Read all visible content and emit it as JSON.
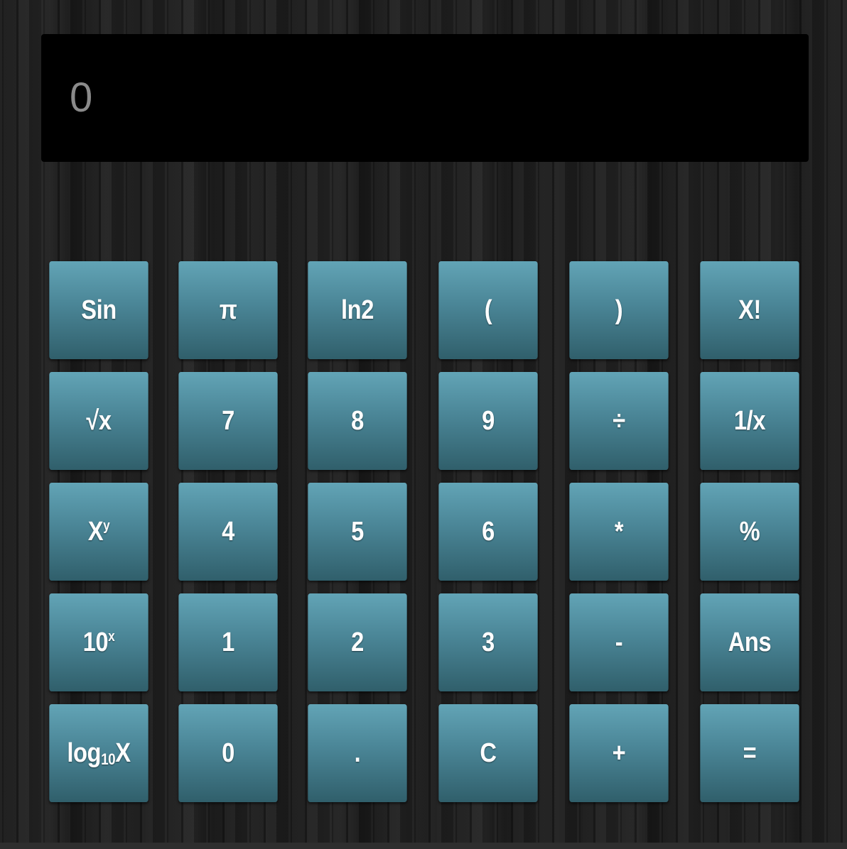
{
  "display": {
    "value": "0"
  },
  "keys": [
    {
      "label": "Sin"
    },
    {
      "label": "π"
    },
    {
      "label": "ln2"
    },
    {
      "label": "("
    },
    {
      "label": ")"
    },
    {
      "label": "X!"
    },
    {
      "label": "√x"
    },
    {
      "label": "7"
    },
    {
      "label": "8"
    },
    {
      "label": "9"
    },
    {
      "label": "÷"
    },
    {
      "label": "1/x"
    },
    {
      "base": "X",
      "sup": "y"
    },
    {
      "label": "4"
    },
    {
      "label": "5"
    },
    {
      "label": "6"
    },
    {
      "label": "*"
    },
    {
      "label": "%"
    },
    {
      "base": "10",
      "sup": "x"
    },
    {
      "label": "1"
    },
    {
      "label": "2"
    },
    {
      "label": "3"
    },
    {
      "label": "-"
    },
    {
      "label": "Ans"
    },
    {
      "pre": "log",
      "sub": "10",
      "post": "X"
    },
    {
      "label": "0"
    },
    {
      "label": "."
    },
    {
      "label": "C"
    },
    {
      "label": "+"
    },
    {
      "label": "="
    }
  ],
  "colors": {
    "key_top": "#62a4b6",
    "key_bottom": "#305f6b",
    "display_bg": "#000000",
    "display_text": "#8a8a8a"
  }
}
